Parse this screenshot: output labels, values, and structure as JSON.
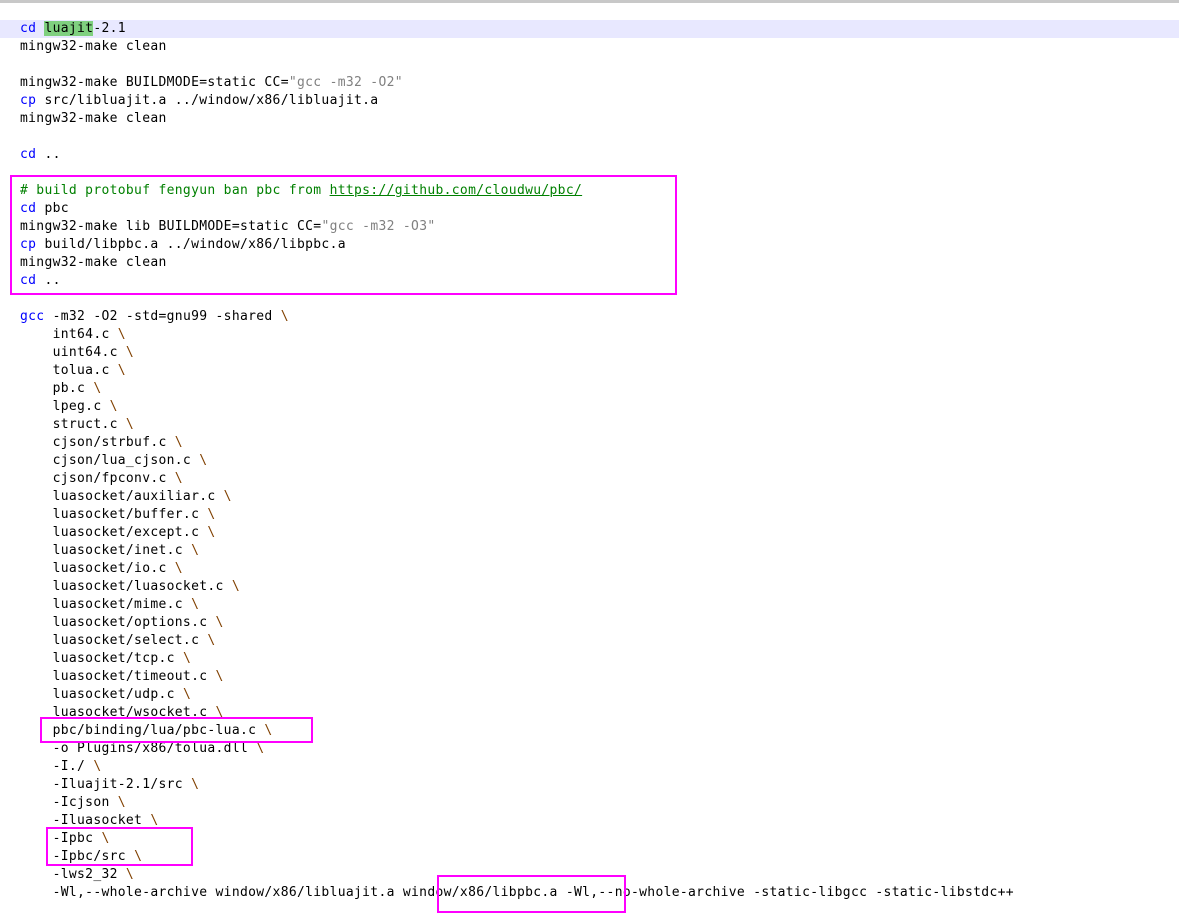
{
  "colors": {
    "keyword": "#0000ff",
    "string": "#808080",
    "operator": "#804000",
    "comment": "#008000",
    "match_highlight": "#7fd07f",
    "current_line": "#e8e8ff",
    "annotation_box": "#ff00ff"
  },
  "lines": [
    {
      "current": true,
      "tokens": [
        {
          "t": "cd",
          "c": "kw"
        },
        {
          "t": " "
        },
        {
          "t": "luajit",
          "c": "hl"
        },
        {
          "t": "-2.1"
        }
      ]
    },
    {
      "tokens": [
        {
          "t": "mingw32-make clean"
        }
      ]
    },
    {
      "tokens": []
    },
    {
      "tokens": [
        {
          "t": "mingw32-make BUILDMODE=static CC="
        },
        {
          "t": "\"gcc -m32 -O2\"",
          "c": "str"
        }
      ]
    },
    {
      "tokens": [
        {
          "t": "cp",
          "c": "kw"
        },
        {
          "t": " src/libluajit.a ../window/x86/libluajit.a"
        }
      ]
    },
    {
      "tokens": [
        {
          "t": "mingw32-make clean"
        }
      ]
    },
    {
      "tokens": []
    },
    {
      "tokens": [
        {
          "t": "cd",
          "c": "kw"
        },
        {
          "t": " .."
        }
      ]
    },
    {
      "tokens": []
    },
    {
      "tokens": [
        {
          "t": "# build protobuf fengyun ban pbc from ",
          "c": "cmt"
        },
        {
          "t": "https://github.com/cloudwu/pbc/",
          "c": "url"
        }
      ]
    },
    {
      "tokens": [
        {
          "t": "cd",
          "c": "kw"
        },
        {
          "t": " pbc"
        }
      ]
    },
    {
      "tokens": [
        {
          "t": "mingw32-make lib BUILDMODE=static CC="
        },
        {
          "t": "\"gcc -m32 -O3\"",
          "c": "str"
        }
      ]
    },
    {
      "tokens": [
        {
          "t": "cp",
          "c": "kw"
        },
        {
          "t": " build/libpbc.a ../window/x86/libpbc.a"
        }
      ]
    },
    {
      "tokens": [
        {
          "t": "mingw32-make clean"
        }
      ]
    },
    {
      "tokens": [
        {
          "t": "cd",
          "c": "kw"
        },
        {
          "t": " .."
        }
      ]
    },
    {
      "tokens": []
    },
    {
      "tokens": [
        {
          "t": "gcc",
          "c": "kw"
        },
        {
          "t": " -m32 -O2 -std=gnu99 -shared "
        },
        {
          "t": "\\",
          "c": "op"
        }
      ]
    },
    {
      "tokens": [
        {
          "t": "    int64.c "
        },
        {
          "t": "\\",
          "c": "op"
        }
      ]
    },
    {
      "tokens": [
        {
          "t": "    uint64.c "
        },
        {
          "t": "\\",
          "c": "op"
        }
      ]
    },
    {
      "tokens": [
        {
          "t": "    tolua.c "
        },
        {
          "t": "\\",
          "c": "op"
        }
      ]
    },
    {
      "tokens": [
        {
          "t": "    pb.c "
        },
        {
          "t": "\\",
          "c": "op"
        }
      ]
    },
    {
      "tokens": [
        {
          "t": "    lpeg.c "
        },
        {
          "t": "\\",
          "c": "op"
        }
      ]
    },
    {
      "tokens": [
        {
          "t": "    struct.c "
        },
        {
          "t": "\\",
          "c": "op"
        }
      ]
    },
    {
      "tokens": [
        {
          "t": "    cjson/strbuf.c "
        },
        {
          "t": "\\",
          "c": "op"
        }
      ]
    },
    {
      "tokens": [
        {
          "t": "    cjson/lua_cjson.c "
        },
        {
          "t": "\\",
          "c": "op"
        }
      ]
    },
    {
      "tokens": [
        {
          "t": "    cjson/fpconv.c "
        },
        {
          "t": "\\",
          "c": "op"
        }
      ]
    },
    {
      "tokens": [
        {
          "t": "    luasocket/auxiliar.c "
        },
        {
          "t": "\\",
          "c": "op"
        }
      ]
    },
    {
      "tokens": [
        {
          "t": "    luasocket/buffer.c "
        },
        {
          "t": "\\",
          "c": "op"
        }
      ]
    },
    {
      "tokens": [
        {
          "t": "    luasocket/except.c "
        },
        {
          "t": "\\",
          "c": "op"
        }
      ]
    },
    {
      "tokens": [
        {
          "t": "    luasocket/inet.c "
        },
        {
          "t": "\\",
          "c": "op"
        }
      ]
    },
    {
      "tokens": [
        {
          "t": "    luasocket/io.c "
        },
        {
          "t": "\\",
          "c": "op"
        }
      ]
    },
    {
      "tokens": [
        {
          "t": "    luasocket/luasocket.c "
        },
        {
          "t": "\\",
          "c": "op"
        }
      ]
    },
    {
      "tokens": [
        {
          "t": "    luasocket/mime.c "
        },
        {
          "t": "\\",
          "c": "op"
        }
      ]
    },
    {
      "tokens": [
        {
          "t": "    luasocket/options.c "
        },
        {
          "t": "\\",
          "c": "op"
        }
      ]
    },
    {
      "tokens": [
        {
          "t": "    luasocket/select.c "
        },
        {
          "t": "\\",
          "c": "op"
        }
      ]
    },
    {
      "tokens": [
        {
          "t": "    luasocket/tcp.c "
        },
        {
          "t": "\\",
          "c": "op"
        }
      ]
    },
    {
      "tokens": [
        {
          "t": "    luasocket/timeout.c "
        },
        {
          "t": "\\",
          "c": "op"
        }
      ]
    },
    {
      "tokens": [
        {
          "t": "    luasocket/udp.c "
        },
        {
          "t": "\\",
          "c": "op"
        }
      ]
    },
    {
      "tokens": [
        {
          "t": "    luasocket/wsocket.c "
        },
        {
          "t": "\\",
          "c": "op"
        }
      ]
    },
    {
      "tokens": [
        {
          "t": "    pbc/binding/lua/pbc-lua.c "
        },
        {
          "t": "\\",
          "c": "op"
        }
      ]
    },
    {
      "tokens": [
        {
          "t": "    -o Plugins/x86/tolua.dll "
        },
        {
          "t": "\\",
          "c": "op"
        }
      ]
    },
    {
      "tokens": [
        {
          "t": "    -I./ "
        },
        {
          "t": "\\",
          "c": "op"
        }
      ]
    },
    {
      "tokens": [
        {
          "t": "    -Iluajit-2.1/src "
        },
        {
          "t": "\\",
          "c": "op"
        }
      ]
    },
    {
      "tokens": [
        {
          "t": "    -Icjson "
        },
        {
          "t": "\\",
          "c": "op"
        }
      ]
    },
    {
      "tokens": [
        {
          "t": "    -Iluasocket "
        },
        {
          "t": "\\",
          "c": "op"
        }
      ]
    },
    {
      "tokens": [
        {
          "t": "    -Ipbc "
        },
        {
          "t": "\\",
          "c": "op"
        }
      ]
    },
    {
      "tokens": [
        {
          "t": "    -Ipbc/src "
        },
        {
          "t": "\\",
          "c": "op"
        }
      ]
    },
    {
      "tokens": [
        {
          "t": "    -lws2_32 "
        },
        {
          "t": "\\",
          "c": "op"
        }
      ]
    },
    {
      "tokens": [
        {
          "t": "    -Wl,--whole-archive window/x86/libluajit.a window/x86/libpbc.a -Wl,--no-whole-archive -static-libgcc -static-libstdc++"
        }
      ]
    }
  ]
}
